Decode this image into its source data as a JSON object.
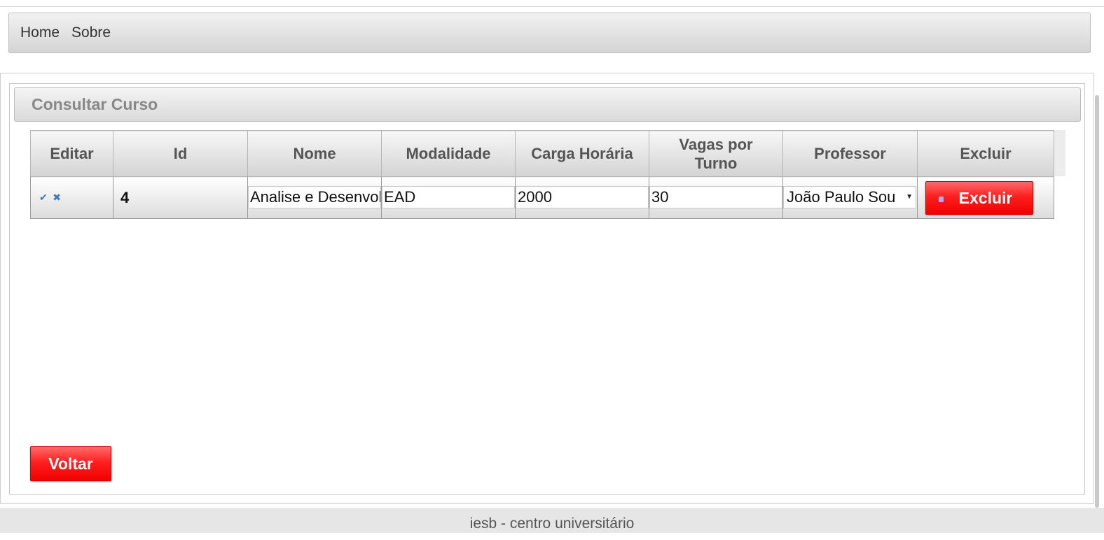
{
  "nav": {
    "items": [
      "Home",
      "Sobre"
    ]
  },
  "panel": {
    "title": "Consultar Curso"
  },
  "table": {
    "headers": {
      "editar": "Editar",
      "id": "Id",
      "nome": "Nome",
      "modalidade": "Modalidade",
      "carga": "Carga Horária",
      "vagas_line1": "Vagas por",
      "vagas_line2": "Turno",
      "professor": "Professor",
      "excluir": "Excluir"
    },
    "rows": [
      {
        "edit_icons": [
          "✔",
          "✖"
        ],
        "id": "4",
        "nome": "Analise e Desenvolvimento",
        "modalidade": "EAD",
        "carga": "2000",
        "vagas": "30",
        "professor": "João Paulo Sou",
        "excluir_label": "Excluir"
      }
    ]
  },
  "buttons": {
    "voltar": "Voltar"
  },
  "footer": {
    "text": "iesb - centro universitário"
  },
  "colors": {
    "danger": "#ff1f1f",
    "edit_icon": "#3a78c9",
    "header_text": "#888888"
  }
}
